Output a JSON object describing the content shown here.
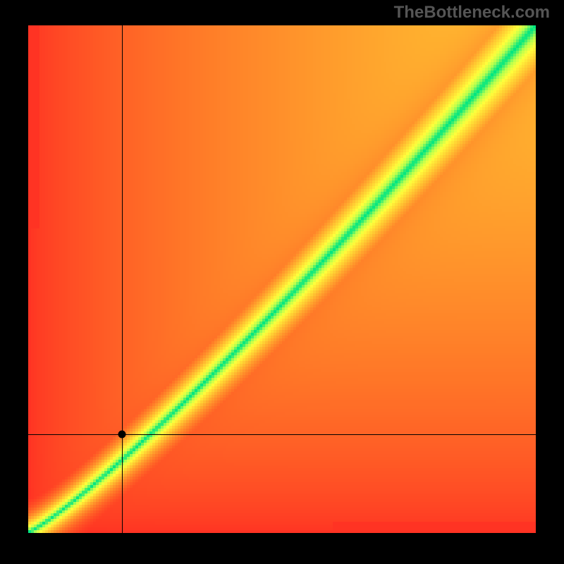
{
  "watermark": "TheBottleneck.com",
  "chart_data": {
    "type": "heatmap",
    "title": "",
    "xlabel": "",
    "ylabel": "",
    "xlim": [
      0,
      1
    ],
    "ylim": [
      0,
      1
    ],
    "resolution": 180,
    "color_stops": [
      {
        "t": 0.0,
        "rgb": [
          255,
          34,
          34
        ]
      },
      {
        "t": 0.25,
        "rgb": [
          255,
          120,
          40
        ]
      },
      {
        "t": 0.5,
        "rgb": [
          255,
          200,
          50
        ]
      },
      {
        "t": 0.7,
        "rgb": [
          255,
          255,
          60
        ]
      },
      {
        "t": 0.85,
        "rgb": [
          180,
          255,
          80
        ]
      },
      {
        "t": 1.0,
        "rgb": [
          0,
          230,
          130
        ]
      }
    ],
    "ridge": {
      "description": "Center of the green optimal band as a function of x (normalized 0..1). y grows slightly super-linearly with x.",
      "gamma": 1.15,
      "half_width": 0.045,
      "falloff_sharpness": 1.2
    },
    "marker": {
      "x": 0.185,
      "y": 0.195
    },
    "crosshair": {
      "x": 0.185,
      "y": 0.195
    }
  }
}
